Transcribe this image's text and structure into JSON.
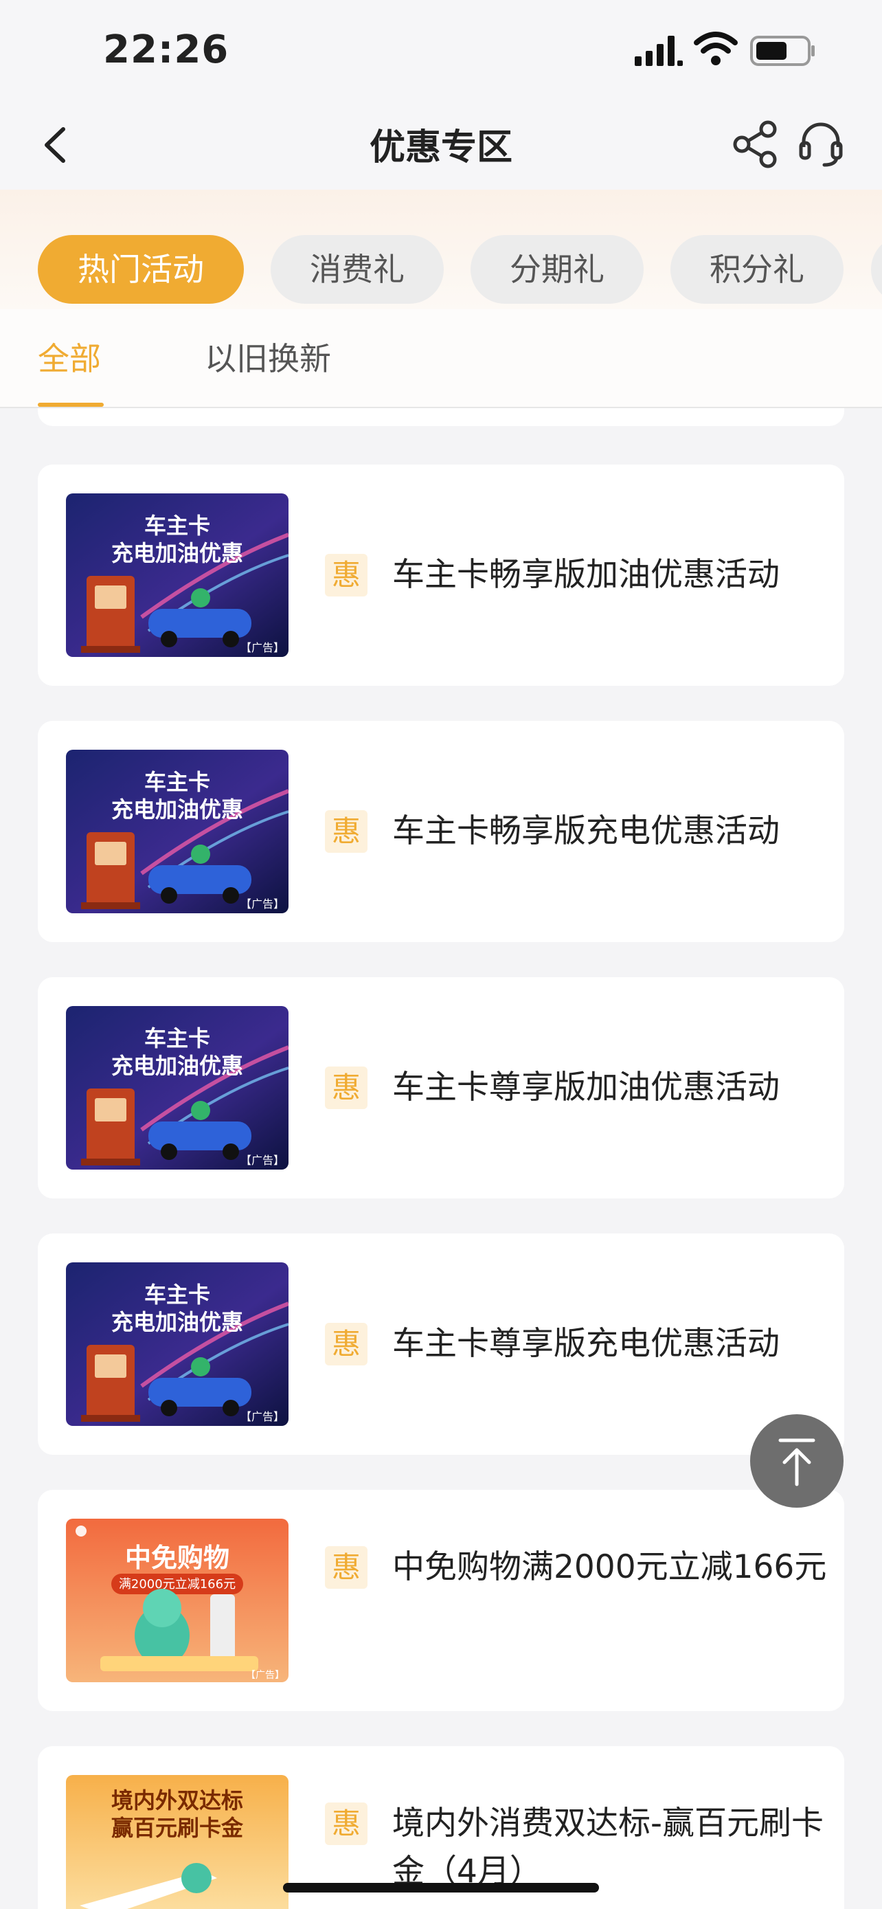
{
  "status": {
    "time": "22:26"
  },
  "nav": {
    "title": "优惠专区"
  },
  "categories": [
    {
      "label": "热门活动",
      "active": true
    },
    {
      "label": "消费礼",
      "active": false
    },
    {
      "label": "分期礼",
      "active": false
    },
    {
      "label": "积分礼",
      "active": false
    }
  ],
  "subtabs": [
    {
      "label": "全部",
      "active": true
    },
    {
      "label": "以旧换新",
      "active": false
    }
  ],
  "badge_label": "惠",
  "items": [
    {
      "title": "车主卡畅享版加油优惠活动",
      "banner": {
        "line1": "车主卡",
        "line2": "充电加油优惠",
        "ad": "【广告】"
      }
    },
    {
      "title": "车主卡畅享版充电优惠活动",
      "banner": {
        "line1": "车主卡",
        "line2": "充电加油优惠",
        "ad": "【广告】"
      }
    },
    {
      "title": "车主卡尊享版加油优惠活动",
      "banner": {
        "line1": "车主卡",
        "line2": "充电加油优惠",
        "ad": "【广告】"
      }
    },
    {
      "title": "车主卡尊享版充电优惠活动",
      "banner": {
        "line1": "车主卡",
        "line2": "充电加油优惠",
        "ad": "【广告】"
      }
    },
    {
      "title": "中免购物满2000元立减166元",
      "banner": {
        "line1": "中免购物",
        "line2": "满2000元立减166元",
        "ad": "【广告】"
      }
    },
    {
      "title": "境内外消费双达标-赢百元刷卡金（4月）",
      "banner": {
        "line1": "境内外双达标",
        "line2": "赢百元刷卡金",
        "ad": ""
      }
    }
  ],
  "colors": {
    "accent": "#f0ab32",
    "chip_inactive": "#ececec",
    "badge_bg": "#fdf1dc"
  },
  "icons": [
    "back-icon",
    "share-icon",
    "customer-service-icon",
    "back-to-top-icon"
  ]
}
